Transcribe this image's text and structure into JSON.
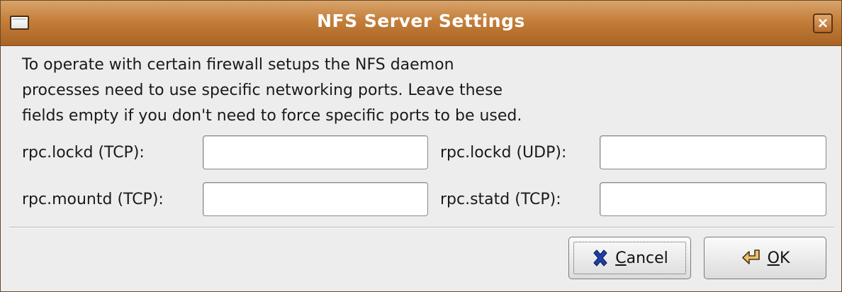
{
  "window": {
    "title": "NFS Server Settings",
    "close_glyph": "×"
  },
  "description": {
    "lines": [
      "To operate with certain firewall setups the NFS daemon",
      "processes need to use specific networking ports. Leave these",
      "fields empty if you don't need to force specific ports to be used."
    ]
  },
  "fields": {
    "lockd_tcp": {
      "label": "rpc.lockd (TCP):",
      "value": ""
    },
    "lockd_udp": {
      "label": "rpc.lockd (UDP):",
      "value": ""
    },
    "mountd_tcp": {
      "label": "rpc.mountd (TCP):",
      "value": ""
    },
    "statd_tcp": {
      "label": "rpc.statd (TCP):",
      "value": ""
    }
  },
  "buttons": {
    "cancel": {
      "mnemonic": "C",
      "rest": "ancel",
      "icon": "cancel-x-icon",
      "focused": true
    },
    "ok": {
      "mnemonic": "O",
      "rest": "K",
      "icon": "ok-enter-arrow-icon"
    }
  },
  "colors": {
    "titlebar": "#c47e3a",
    "window_bg": "#ededed",
    "cancel_icon": "#1f3fa8"
  }
}
